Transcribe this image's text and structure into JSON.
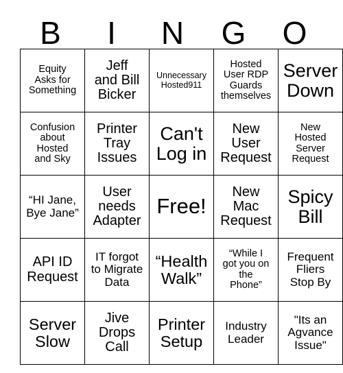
{
  "card": {
    "header": [
      "B",
      "I",
      "N",
      "G",
      "O"
    ],
    "rows": [
      [
        {
          "text": "Equity\nAsks for\nSomething",
          "size": "fs-s"
        },
        {
          "text": "Jeff\nand Bill\nBicker",
          "size": "fs-l"
        },
        {
          "text": "Unnecessary\nHosted911",
          "size": "fs-xs"
        },
        {
          "text": "Hosted\nUser RDP\nGuards\nthemselves",
          "size": "fs-s"
        },
        {
          "text": "Server\nDown",
          "size": "fs-xxl"
        }
      ],
      [
        {
          "text": "Confusion\nabout\nHosted\nand Sky",
          "size": "fs-s"
        },
        {
          "text": "Printer\nTray\nIssues",
          "size": "fs-l"
        },
        {
          "text": "Can't\nLog in",
          "size": "fs-xxl"
        },
        {
          "text": "New\nUser\nRequest",
          "size": "fs-l"
        },
        {
          "text": "New\nHosted\nServer\nRequest",
          "size": "fs-s"
        }
      ],
      [
        {
          "text": "“HI Jane,\nBye Jane”",
          "size": "fs-m"
        },
        {
          "text": "User\nneeds\nAdapter",
          "size": "fs-l"
        },
        {
          "text": "Free!",
          "size": "fs-free"
        },
        {
          "text": "New\nMac\nRequest",
          "size": "fs-l"
        },
        {
          "text": "Spicy\nBill",
          "size": "fs-xxl"
        }
      ],
      [
        {
          "text": "API ID\nRequest",
          "size": "fs-l"
        },
        {
          "text": "IT forgot\nto Migrate\nData",
          "size": "fs-m"
        },
        {
          "text": "“Health\nWalk”",
          "size": "fs-xl"
        },
        {
          "text": "“While I\ngot you on\nthe\nPhone”",
          "size": "fs-s"
        },
        {
          "text": "Frequent\nFliers\nStop By",
          "size": "fs-m"
        }
      ],
      [
        {
          "text": "Server\nSlow",
          "size": "fs-xl"
        },
        {
          "text": "Jive\nDrops\nCall",
          "size": "fs-l"
        },
        {
          "text": "Printer\nSetup",
          "size": "fs-xl"
        },
        {
          "text": "Industry\nLeader",
          "size": "fs-m"
        },
        {
          "text": "\"Its an\nAgvance\nIssue\"",
          "size": "fs-m"
        }
      ]
    ]
  },
  "colors": {
    "border": "#000000",
    "text": "#000000",
    "background": "#ffffff"
  }
}
